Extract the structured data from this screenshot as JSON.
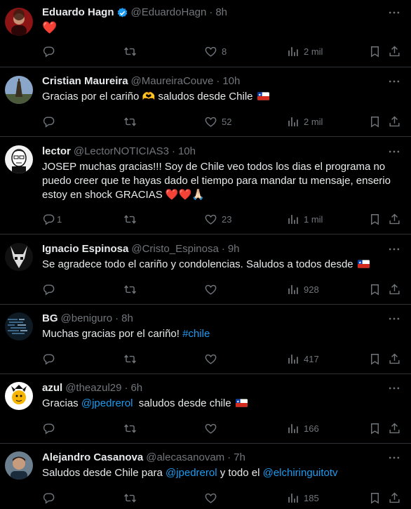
{
  "tweets": [
    {
      "name": "Eduardo Hagn",
      "handle": "@EduardoHagn",
      "time": "8h",
      "verified": true,
      "text": "❤️",
      "replies": "",
      "retweets": "",
      "likes": "8",
      "views": "2 mil"
    },
    {
      "name": "Cristian Maureira",
      "handle": "@MaureiraCouve",
      "time": "10h",
      "text": "Gracias por el cariño 🫶 saludos desde Chile",
      "flag": "🇨🇱",
      "replies": "",
      "retweets": "",
      "likes": "52",
      "views": "2 mil"
    },
    {
      "name": "lector",
      "handle": "@LectorNOTICIAS3",
      "time": "10h",
      "text": "JOSEP muchas gracias!!! Soy de Chile veo todos los dias el programa no puedo creer que te hayas dado el tiempo para mandar tu mensaje, enserio estoy en shock GRACIAS ❤️❤️🙏🏻",
      "replies": "1",
      "retweets": "",
      "likes": "23",
      "views": "1 mil"
    },
    {
      "name": "Ignacio Espinosa",
      "handle": "@Cristo_Espinosa",
      "time": "9h",
      "text": "Se agradece todo el cariño y condolencias. Saludos a todos desde",
      "flag": "🇨🇱",
      "replies": "",
      "retweets": "",
      "likes": "",
      "views": "928"
    },
    {
      "name": "BG",
      "handle": "@beniguro",
      "time": "8h",
      "text_pre": "Muchas gracias por el cariño! ",
      "hashtag": "#chile",
      "replies": "",
      "retweets": "",
      "likes": "",
      "views": "417"
    },
    {
      "name": "azul",
      "handle": "@theazul29",
      "time": "6h",
      "text_pre": "Gracias ",
      "mention": "@jpedrerol",
      "text_post": "  saludos desde chile",
      "flag": "🇨🇱",
      "replies": "",
      "retweets": "",
      "likes": "",
      "views": "166"
    },
    {
      "name": "Alejandro Casanova",
      "handle": "@alecasanovam",
      "time": "7h",
      "text_pre": "Saludos desde Chile para ",
      "mention": "@jpedrerol",
      "text_mid": " y todo el ",
      "mention2": "@elchiringuitotv",
      "replies": "",
      "retweets": "",
      "likes": "",
      "views": "185"
    }
  ],
  "icons": {
    "reply": "reply-icon",
    "retweet": "retweet-icon",
    "like": "heart-icon",
    "views": "views-icon",
    "bookmark": "bookmark-icon",
    "share": "share-icon",
    "more": "more-icon",
    "verified": "verified-badge-icon"
  },
  "colors": {
    "background": "#000000",
    "text": "#e7e9ea",
    "muted": "#71767b",
    "accent": "#1d9bf0",
    "border": "#2f3336"
  }
}
